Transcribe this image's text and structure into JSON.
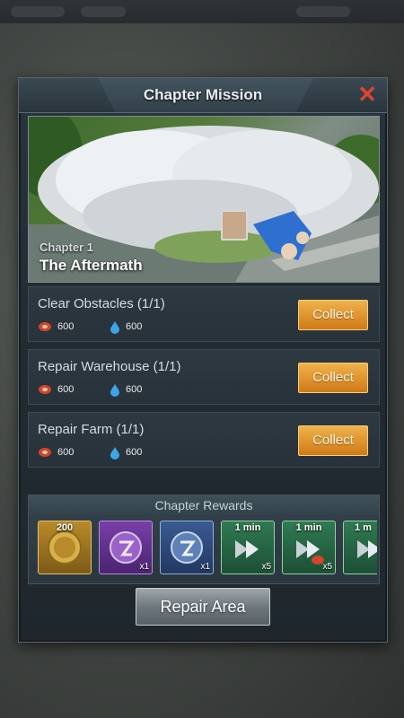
{
  "dialog": {
    "title": "Chapter Mission",
    "close_icon": "close-icon"
  },
  "banner": {
    "chapter_label": "Chapter 1",
    "chapter_name": "The Aftermath"
  },
  "missions": [
    {
      "name": "Clear Obstacles (1/1)",
      "meat": "600",
      "water": "600",
      "button": "Collect"
    },
    {
      "name": "Repair Warehouse (1/1)",
      "meat": "600",
      "water": "600",
      "button": "Collect"
    },
    {
      "name": "Repair Farm (1/1)",
      "meat": "600",
      "water": "600",
      "button": "Collect"
    }
  ],
  "rewards": {
    "title": "Chapter Rewards",
    "items": [
      {
        "icon": "gold-coin-icon",
        "label": "200",
        "count": ""
      },
      {
        "icon": "purple-badge-icon",
        "label": "",
        "count": "x1"
      },
      {
        "icon": "blue-badge-icon",
        "label": "",
        "count": "x1"
      },
      {
        "icon": "speedup-icon",
        "label": "1 min",
        "count": "x5"
      },
      {
        "icon": "speedup-icon",
        "label": "1 min",
        "count": "x5"
      },
      {
        "icon": "speedup-icon",
        "label": "1 m",
        "count": ""
      }
    ]
  },
  "footer": {
    "repair_button": "Repair Area"
  },
  "colors": {
    "accent_orange": "#e49a30",
    "close_red": "#e0432f",
    "panel_bg": "#232c33"
  }
}
